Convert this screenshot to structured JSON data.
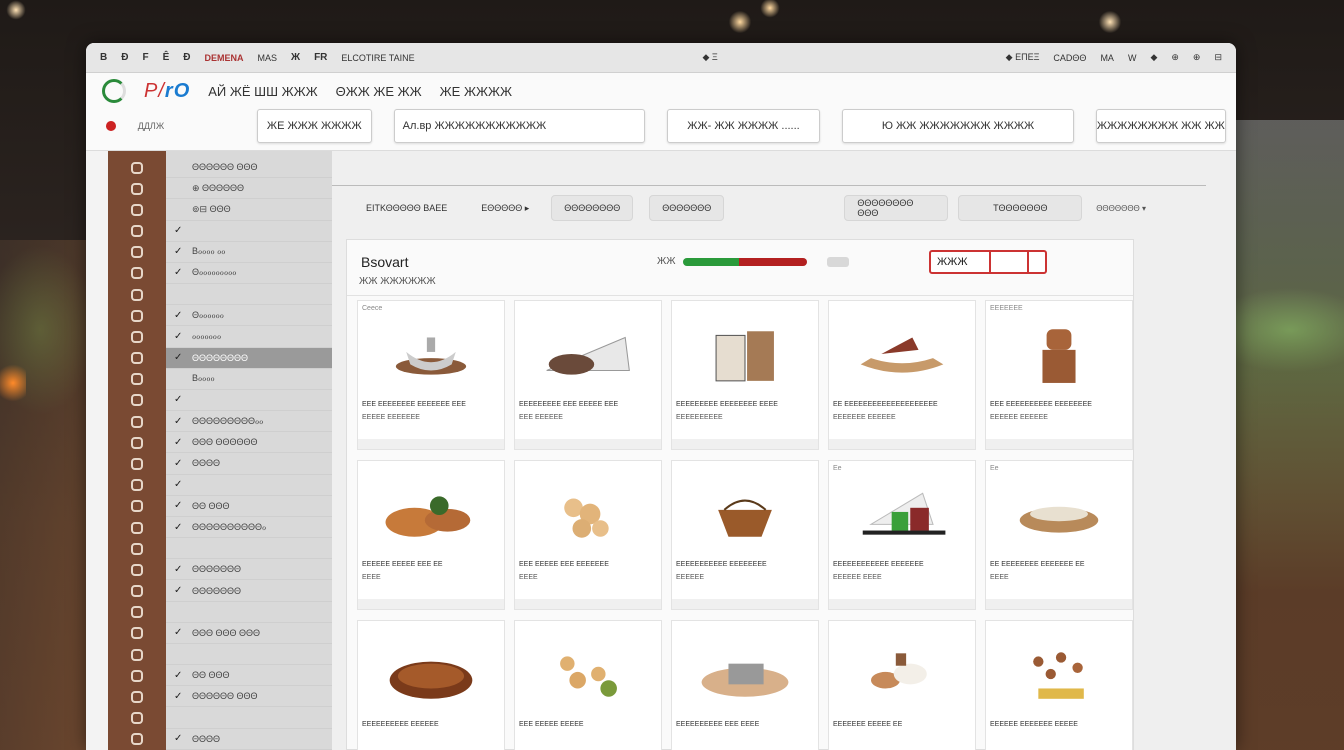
{
  "window": {
    "titlebar_left": [
      "B",
      "Ð",
      "F",
      "Ê",
      "Ð"
    ],
    "brand": "DEMENA",
    "titlebar_items": [
      "MAS",
      "Ж",
      "FR",
      "ELCOTIRE TAINE"
    ],
    "titlebar_center": "◆ Ξ",
    "titlebar_right": [
      "◆ ΕΠΕΞ",
      "CADΘΘ",
      "MA",
      "W",
      "◆",
      "⊕",
      "⊕",
      "⊟"
    ]
  },
  "toolbar": {
    "logo_text": "P/",
    "logo_blue": "rO",
    "menu_text_1": "АЙ ЖЁ ШШ ЖЖЖ",
    "menu_text_2": "ΘЖЖ ЖЕ ЖЖ",
    "menu_text_3": "ЖЕ ЖЖЖЖ",
    "row2_label": "ДДЛЖ",
    "boxes": [
      "ЖЕ ЖЖЖ ЖЖЖЖ",
      "Ал.вр     ЖЖЖЖЖЖЖЖЖЖЖ",
      "ЖЖ- ЖЖ ЖЖЖЖ ......",
      "Ю ЖЖ ЖЖЖЖЖЖЖ ЖЖЖЖ",
      "ЖЖЖЖЖЖЖЖ ЖЖ ЖЖ"
    ]
  },
  "sidebar": {
    "items": [
      {
        "mark": "",
        "label": "ΘΘΘΘΘΘ ΘΘΘ",
        "active": false
      },
      {
        "mark": "",
        "label": "⊕ ΘΘΘΘΘΘ",
        "active": false
      },
      {
        "mark": "",
        "label": "⊚⊟ ΘΘΘ",
        "active": false
      },
      {
        "mark": "✓",
        "label": "",
        "active": false
      },
      {
        "mark": "✓",
        "label": "Bℴℴℴℴ ℴℴ",
        "active": false
      },
      {
        "mark": "✓",
        "label": "Θℴℴℴℴℴℴℴℴℴ",
        "active": false
      },
      {
        "mark": "",
        "label": "",
        "active": false
      },
      {
        "mark": "✓",
        "label": "Θℴℴℴℴℴℴ",
        "active": false
      },
      {
        "mark": "✓",
        "label": "ℴℴℴℴℴℴℴ",
        "active": false
      },
      {
        "mark": "✓",
        "label": "ΘΘΘΘΘΘΘΘ",
        "active": true
      },
      {
        "mark": "",
        "label": "Bℴℴℴℴ",
        "active": false
      },
      {
        "mark": "✓",
        "label": "",
        "active": false
      },
      {
        "mark": "✓",
        "label": "ΘΘΘΘΘΘΘΘΘℴℴ",
        "active": false
      },
      {
        "mark": "✓",
        "label": "ΘΘΘ ΘΘΘΘΘΘ",
        "active": false
      },
      {
        "mark": "✓",
        "label": "ΘΘΘΘ",
        "active": false
      },
      {
        "mark": "✓",
        "label": "",
        "active": false
      },
      {
        "mark": "✓",
        "label": "ΘΘ ΘΘΘ",
        "active": false
      },
      {
        "mark": "✓",
        "label": "ΘΘΘΘΘΘΘΘΘΘℴ",
        "active": false
      },
      {
        "mark": "",
        "label": "",
        "active": false
      },
      {
        "mark": "✓",
        "label": "ΘΘΘΘΘΘΘ",
        "active": false
      },
      {
        "mark": "✓",
        "label": "ΘΘΘΘΘΘΘ",
        "active": false
      },
      {
        "mark": "",
        "label": "",
        "active": false
      },
      {
        "mark": "✓",
        "label": "ΘΘΘ ΘΘΘ ΘΘΘ",
        "active": false
      },
      {
        "mark": "",
        "label": "",
        "active": false
      },
      {
        "mark": "✓",
        "label": "ΘΘ ΘΘΘ",
        "active": false
      },
      {
        "mark": "✓",
        "label": "ΘΘΘΘΘΘ ΘΘΘ",
        "active": false
      },
      {
        "mark": "",
        "label": "",
        "active": false
      },
      {
        "mark": "✓",
        "label": "ΘΘΘΘ",
        "active": false
      }
    ]
  },
  "filters": {
    "label": "ΕΙΤΚΘΘΘΘΘ ΒΑΕΕ",
    "btn1": "ΕΘΘΘΘΘ ▸",
    "btn2": "ΘΘΘΘΘΘΘΘ",
    "btn3": "ΘΘΘΘΘΘΘ",
    "btn4": "ΘΘΘΘΘΘΘΘ ΘΘΘ",
    "btn5": "ΤΘΘΘΘΘΘΘ",
    "sort": "ΘΘΘΘΘΘΘ ▾"
  },
  "panel": {
    "title": "Bsovart",
    "subtitle": "ЖЖ ЖЖЖЖЖЖ",
    "progress_label": "ЖЖ",
    "progress_green_fraction": 0.45,
    "progress_red_fraction": 0.55,
    "search_value": "ЖЖЖ"
  },
  "products": [
    {
      "cap": "Сeесe",
      "t1": "ЕЕЕ ЕЕЕЕЕЕЕЕ ЕЕЕЕЕЕЕ ЕЕЕ",
      "t2": "ЕЕЕЕЕ ЕЕЕЕЕЕЕ",
      "icon": "bowl-icon"
    },
    {
      "cap": "",
      "t1": "ЕЕЕЕЕЕЕЕЕ ЕЕЕ ЕЕЕЕЕ ЕЕЕ",
      "t2": "ЕЕЕ ЕЕЕЕЕЕ",
      "icon": "pastry-icon"
    },
    {
      "cap": "",
      "t1": "ЕЕЕЕЕЕЕЕЕ ЕЕЕЕЕЕЕЕ ЕЕЕЕ",
      "t2": "ЕЕЕЕЕЕЕЕЕЕ",
      "icon": "coffee-bag-icon"
    },
    {
      "cap": "",
      "t1": "ЕЕ ЕЕЕЕЕЕЕЕЕЕЕЕЕЕЕЕЕЕЕЕ",
      "t2": "ЕЕЕЕЕЕЕ ЕЕЕЕЕЕ",
      "icon": "boat-dish-icon"
    },
    {
      "cap": "ЕЕЕЕЕЕЕ",
      "t1": "ЕЕЕ ЕЕЕЕЕЕЕЕЕЕ ЕЕЕЕЕЕЕЕ",
      "t2": "ЕЕЕЕЕЕ ЕЕЕЕЕЕ",
      "icon": "figurine-icon"
    },
    {
      "cap": "",
      "t1": "ЕЕЕЕЕЕ ЕЕЕЕЕ ЕЕЕ ЕЕ",
      "t2": "ЕЕЕЕ",
      "icon": "bread-icon"
    },
    {
      "cap": "",
      "t1": "ЕЕЕ ЕЕЕЕЕ ЕЕЕ ЕЕЕЕЕЕЕ",
      "t2": "ЕЕЕЕ",
      "icon": "popcorn-icon"
    },
    {
      "cap": "",
      "t1": "ЕЕЕЕЕЕЕЕЕЕЕ ЕЕЕЕЕЕЕЕ",
      "t2": "ЕЕЕЕЕЕ",
      "icon": "basket-icon"
    },
    {
      "cap": "Ее",
      "t1": "ЕЕЕЕЕЕЕЕЕЕЕЕ ЕЕЕЕЕЕЕ",
      "t2": "ЕЕЕЕЕЕ ЕЕЕЕ",
      "icon": "plate-icon"
    },
    {
      "cap": "Ее",
      "t1": "ЕЕ ЕЕЕЕЕЕЕЕ ЕЕЕЕЕЕЕ ЕЕ",
      "t2": "ЕЕЕЕ",
      "icon": "tapas-icon"
    },
    {
      "cap": "",
      "t1": "ЕЕЕЕЕЕЕЕЕЕ ЕЕЕЕЕЕ",
      "t2": "",
      "icon": "tart-icon"
    },
    {
      "cap": "",
      "t1": "ЕЕЕ ЕЕЕЕЕ ЕЕЕЕЕ",
      "t2": "",
      "icon": "nuggets-icon"
    },
    {
      "cap": "",
      "t1": "ЕЕЕЕЕЕЕЕЕЕ ЕЕЕ ЕЕЕЕ",
      "t2": "",
      "icon": "tray-icon"
    },
    {
      "cap": "",
      "t1": "ЕЕЕЕЕЕЕ ЕЕЕЕЕ ЕЕ",
      "t2": "",
      "icon": "bread-rolls-icon"
    },
    {
      "cap": "",
      "t1": "ЕЕЕЕЕЕ ЕЕЕЕЕЕЕ ЕЕЕЕЕ",
      "t2": "",
      "icon": "cookies-icon"
    }
  ],
  "colors": {
    "rail": "#7a4a33",
    "accent_red": "#c33",
    "progress_green": "#2a9a3a",
    "progress_red": "#b32020"
  }
}
